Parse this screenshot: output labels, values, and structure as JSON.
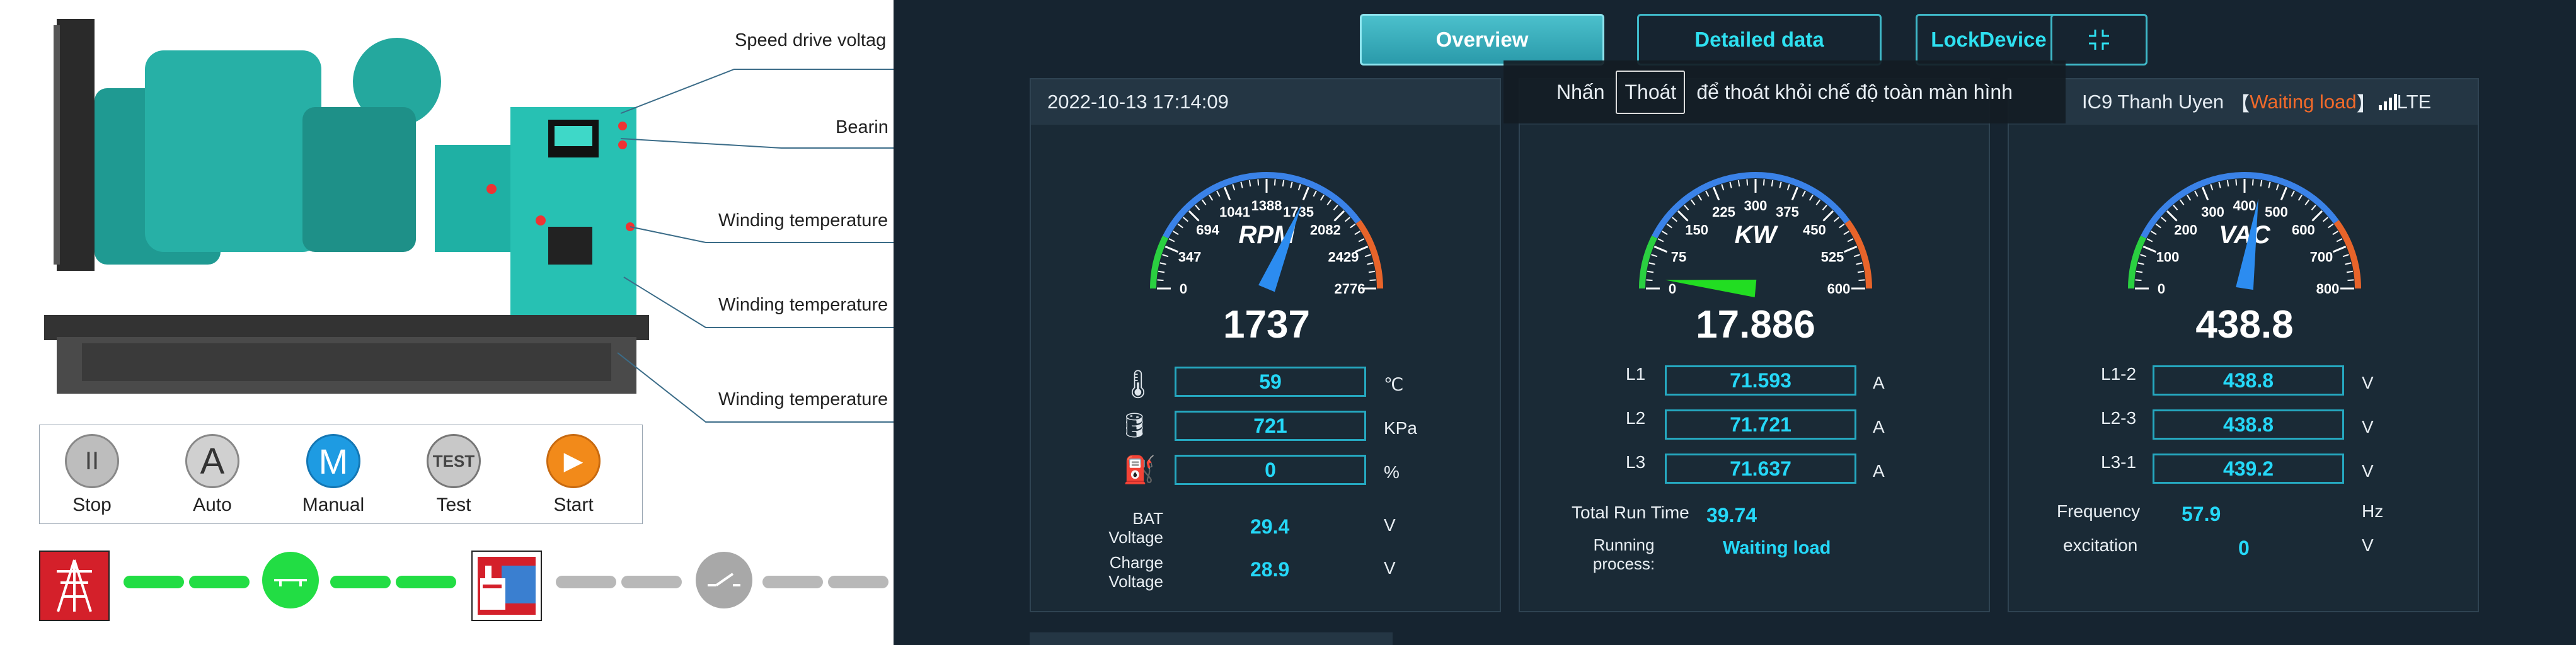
{
  "machine_labels": [
    "Speed drive voltag",
    "Bearin",
    "Winding temperature",
    "Winding temperature",
    "Winding temperature"
  ],
  "controls": [
    {
      "label": "Stop",
      "glyph": "II"
    },
    {
      "label": "Auto",
      "glyph": "A"
    },
    {
      "label": "Manual",
      "glyph": "M"
    },
    {
      "label": "Test",
      "glyph": "TEST"
    },
    {
      "label": "Start",
      "glyph": "▶"
    }
  ],
  "tabs": {
    "overview": "Overview",
    "detailed": "Detailed data",
    "lock": "LockDevice"
  },
  "toast": {
    "prefix": "Nhấn",
    "key": "Thoát",
    "suffix": "để thoát khỏi chế độ toàn màn hình"
  },
  "card1": {
    "timestamp": "2022-10-13 17:14:09",
    "gauge": {
      "unit": "RPM",
      "value": "1737",
      "level": 1737,
      "max": 2776,
      "ticks": [
        "0",
        "347",
        "694",
        "1041",
        "1388",
        "1735",
        "2082",
        "2429",
        "2776"
      ]
    },
    "rows": [
      {
        "icon": "coolant-temp-icon",
        "value": "59",
        "unit": "℃"
      },
      {
        "icon": "oil-pressure-icon",
        "value": "721",
        "unit": "KPa"
      },
      {
        "icon": "fuel-icon",
        "value": "0",
        "unit": "%"
      }
    ],
    "bat": {
      "label1": "BAT",
      "label2": "Voltage",
      "value": "29.4",
      "unit": "V"
    },
    "charge": {
      "label1": "Charge",
      "label2": "Voltage",
      "value": "28.9",
      "unit": "V"
    }
  },
  "card2": {
    "gauge": {
      "unit": "KW",
      "value": "17.886",
      "level": 17.886,
      "max": 600,
      "ticks": [
        "0",
        "75",
        "150",
        "225",
        "300",
        "375",
        "450",
        "525",
        "600"
      ]
    },
    "rows": [
      {
        "label": "L1",
        "value": "71.593",
        "unit": "A"
      },
      {
        "label": "L2",
        "value": "71.721",
        "unit": "A"
      },
      {
        "label": "L3",
        "value": "71.637",
        "unit": "A"
      }
    ],
    "runtime": {
      "label": "Total Run Time",
      "value": "39.74"
    },
    "process": {
      "label1": "Running",
      "label2": "process:",
      "value": "Waiting load"
    }
  },
  "card3": {
    "header": {
      "site": "IC9 Thanh Uyen",
      "bracket_open": "【",
      "status": "Waiting load",
      "bracket_close": "】",
      "network": "LTE"
    },
    "gauge": {
      "unit": "VAC",
      "value": "438.8",
      "level": 438.8,
      "max": 800,
      "ticks": [
        "0",
        "100",
        "200",
        "300",
        "400",
        "500",
        "600",
        "700",
        "800"
      ]
    },
    "rows": [
      {
        "label": "L1-2",
        "value": "438.8",
        "unit": "V"
      },
      {
        "label": "L2-3",
        "value": "438.8",
        "unit": "V"
      },
      {
        "label": "L3-1",
        "value": "439.2",
        "unit": "V"
      }
    ],
    "frequency": {
      "label": "Frequency",
      "value": "57.9",
      "unit": "Hz"
    },
    "excitation": {
      "label": "excitation",
      "value": "0",
      "unit": "V"
    }
  },
  "colors": {
    "bg": "#162430",
    "cyan": "#25d8f8",
    "accent_orange": "#f26a2a",
    "line_green": "#22dd44",
    "line_gray": "#b8b8b8",
    "grid_red": "#d4202a"
  }
}
